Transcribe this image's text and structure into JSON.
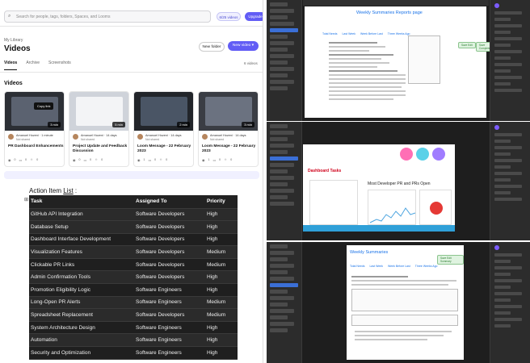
{
  "library": {
    "search_placeholder": "Search for people, tags, folders, Spaces, and Looms",
    "video_count_badge": "6/25 videos",
    "upgrade_label": "Upgrade",
    "breadcrumb": "My Library",
    "title": "Videos",
    "new_folder_label": "New folder",
    "new_video_label": "New video",
    "tabs": [
      "Videos",
      "Archive",
      "Screenshots"
    ],
    "active_tab": "Videos",
    "count_label": "6 videos",
    "section_title": "Videos",
    "copy_link_label": "Copy link",
    "cards": [
      {
        "author": "Amanuel Hozeni · 1 minute",
        "shared": "Not shared",
        "title": "PR Dashboard Enhancements",
        "duration": "3 min",
        "stats": [
          "0",
          "0",
          "0"
        ]
      },
      {
        "author": "Amanuel Hozeni · 14 days",
        "shared": "Not shared",
        "title": "Project Update and Feedback Discussion",
        "duration": "5 min",
        "stats": [
          "0",
          "0",
          "0"
        ]
      },
      {
        "author": "Amanuel Hozeni · 14 days",
        "shared": "Not shared",
        "title": "Loom Message - 22 February 2023",
        "duration": "2 min",
        "stats": [
          "1",
          "0",
          "0"
        ]
      },
      {
        "author": "Amanuel Hozeni · 14 days",
        "shared": "Not shared",
        "title": "Loom Message - 22 February 2023",
        "duration": "3 min",
        "stats": [
          "1",
          "0",
          "0"
        ]
      }
    ]
  },
  "action_items": {
    "heading_prefix": "Action Item",
    "heading_link": "List",
    "heading_suffix": " :",
    "columns": [
      "Task",
      "Assigned To",
      "Priority"
    ],
    "rows": [
      [
        "GitHub API Integration",
        "Software Developers",
        "High"
      ],
      [
        "Database Setup",
        "Software Developers",
        "High"
      ],
      [
        "Dashboard Interface Development",
        "Software Developers",
        "High"
      ],
      [
        "Visualization Features",
        "Software Developers",
        "Medium"
      ],
      [
        "Clickable PR Links",
        "Software Developers",
        "Medium"
      ],
      [
        "Admin Confirmation Tools",
        "Software Developers",
        "High"
      ],
      [
        "Promotion Eligibility Logic",
        "Software Engineers",
        "High"
      ],
      [
        "Long-Open PR Alerts",
        "Software Engineers",
        "Medium"
      ],
      [
        "Spreadsheet Replacement",
        "Software Developers",
        "Medium"
      ],
      [
        "System Architecture Design",
        "Software Engineers",
        "High"
      ],
      [
        "Automation",
        "Software Engineers",
        "High"
      ],
      [
        "Security and Optimization",
        "Software Engineers",
        "High"
      ]
    ]
  },
  "editor1": {
    "page_title": "Weekly Summaries Reports page",
    "tabs": [
      "Total Needs",
      "Last Week",
      "Week Before Last",
      "Three Weeks Ago"
    ],
    "buttons": [
      "Save Edit",
      "Save Completed"
    ]
  },
  "editor2": {
    "header": "Most Developer PR and PRs Open",
    "red_label": "Dashboard Tasks"
  },
  "editor3": {
    "page_title": "Weekly Summaries",
    "tabs": [
      "Total Needs",
      "Last Week",
      "Week Before Last",
      "Three Weeks Ago"
    ],
    "button": "Save Edit Summary"
  }
}
